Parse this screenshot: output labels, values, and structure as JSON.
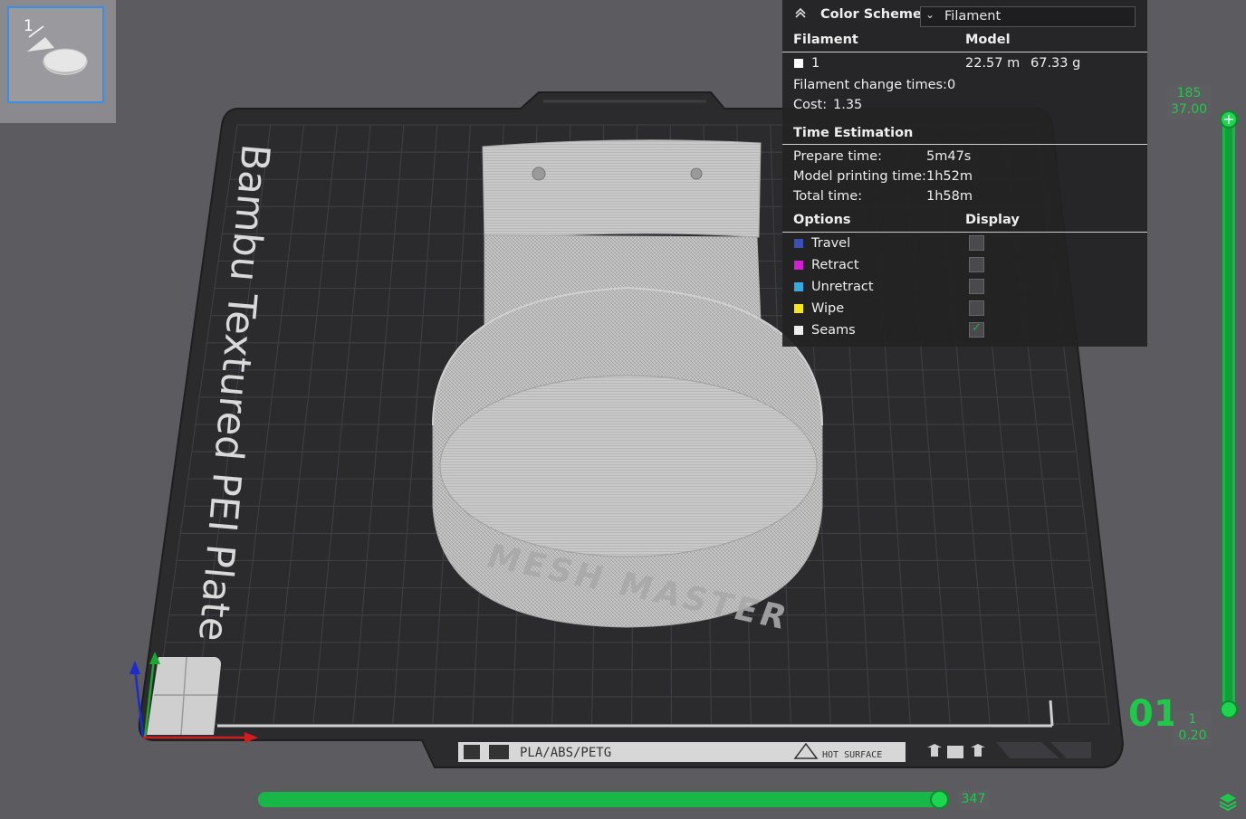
{
  "plate": {
    "number": "1",
    "label": "Bambu Textured PEI Plate",
    "model_text": "MESH MASTER",
    "bed_label": "PLA/ABS/PETG",
    "hot_surface": "HOT SURFACE"
  },
  "color_scheme": {
    "title": "Color Scheme",
    "selected": "Filament"
  },
  "filament_table": {
    "col1": "Filament",
    "col2": "Model",
    "rows": [
      {
        "id": "1",
        "length": "22.57 m",
        "weight": "67.33 g",
        "color": "#ffffff"
      }
    ],
    "change_times_label": "Filament change times:",
    "change_times": "0",
    "cost_label": "Cost:",
    "cost": "1.35"
  },
  "time_estimation": {
    "title": "Time Estimation",
    "rows": [
      {
        "label": "Prepare time:",
        "value": "5m47s"
      },
      {
        "label": "Model printing time:",
        "value": "1h52m"
      },
      {
        "label": "Total time:",
        "value": "1h58m"
      }
    ]
  },
  "options": {
    "col1": "Options",
    "col2": "Display",
    "items": [
      {
        "label": "Travel",
        "color": "#3a4fb8",
        "checked": false
      },
      {
        "label": "Retract",
        "color": "#d21fd2",
        "checked": false
      },
      {
        "label": "Unretract",
        "color": "#38a8e0",
        "checked": false
      },
      {
        "label": "Wipe",
        "color": "#f4e81c",
        "checked": false
      },
      {
        "label": "Seams",
        "color": "#eeeeee",
        "checked": true
      }
    ]
  },
  "layer_slider": {
    "top_layer": "185",
    "top_height": "37.00",
    "bottom_layer": "1",
    "bottom_height": "0.20",
    "big_label": "01"
  },
  "move_slider": {
    "value": "347"
  },
  "colors": {
    "accent": "#1ec94a",
    "selection": "#3a8ee6"
  }
}
